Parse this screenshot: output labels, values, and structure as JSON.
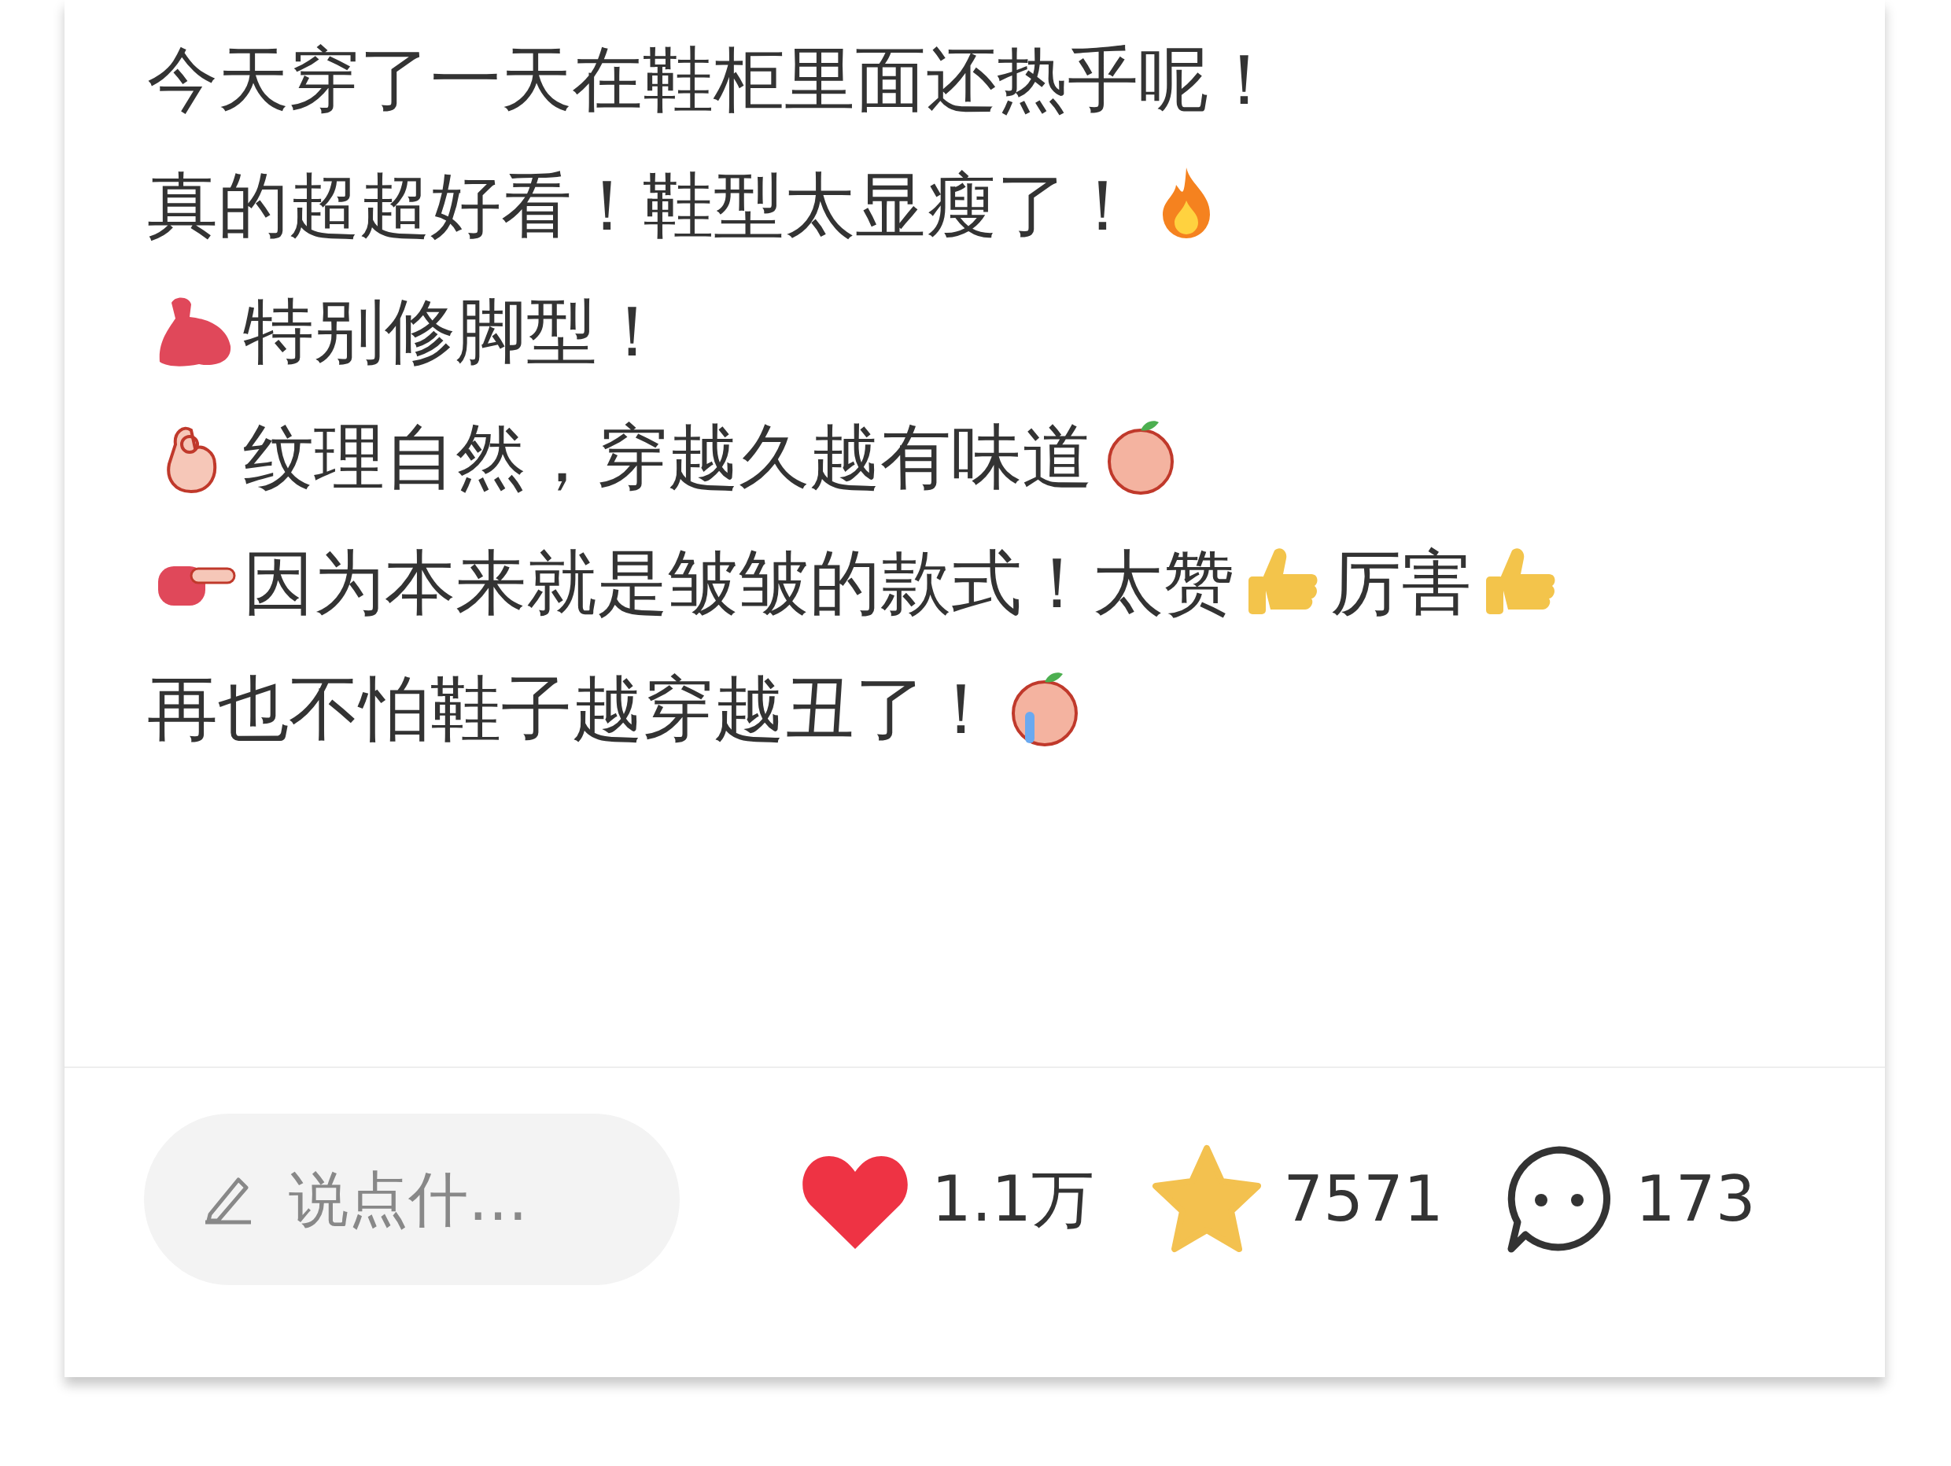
{
  "post": {
    "lines": [
      [
        {
          "kind": "text",
          "text": "今天穿了一天在鞋柜里面还热乎呢！"
        }
      ],
      [
        {
          "kind": "text",
          "text": "真的超超好看！鞋型太显瘦了！"
        },
        {
          "kind": "fire"
        }
      ],
      [
        {
          "kind": "arm"
        },
        {
          "kind": "text",
          "text": "特别修脚型！"
        }
      ],
      [
        {
          "kind": "okhand"
        },
        {
          "kind": "text",
          "text": "纹理自然，穿越久越有味道"
        },
        {
          "kind": "peach"
        }
      ],
      [
        {
          "kind": "pointer"
        },
        {
          "kind": "text",
          "text": "因为本来就是皱皱的款式！太赞"
        },
        {
          "kind": "thumbsup"
        },
        {
          "kind": "text",
          "text": "厉害"
        },
        {
          "kind": "thumbsup"
        }
      ],
      [
        {
          "kind": "text",
          "text": "再也不怕鞋子越穿越丑了！"
        },
        {
          "kind": "crying"
        }
      ]
    ]
  },
  "bottom_bar": {
    "comment_field": {
      "placeholder": "说点什…"
    },
    "likes": {
      "count": "1.1万",
      "liked": true
    },
    "favorites": {
      "count": "7571",
      "collected": true
    },
    "comments": {
      "count": "173"
    }
  }
}
